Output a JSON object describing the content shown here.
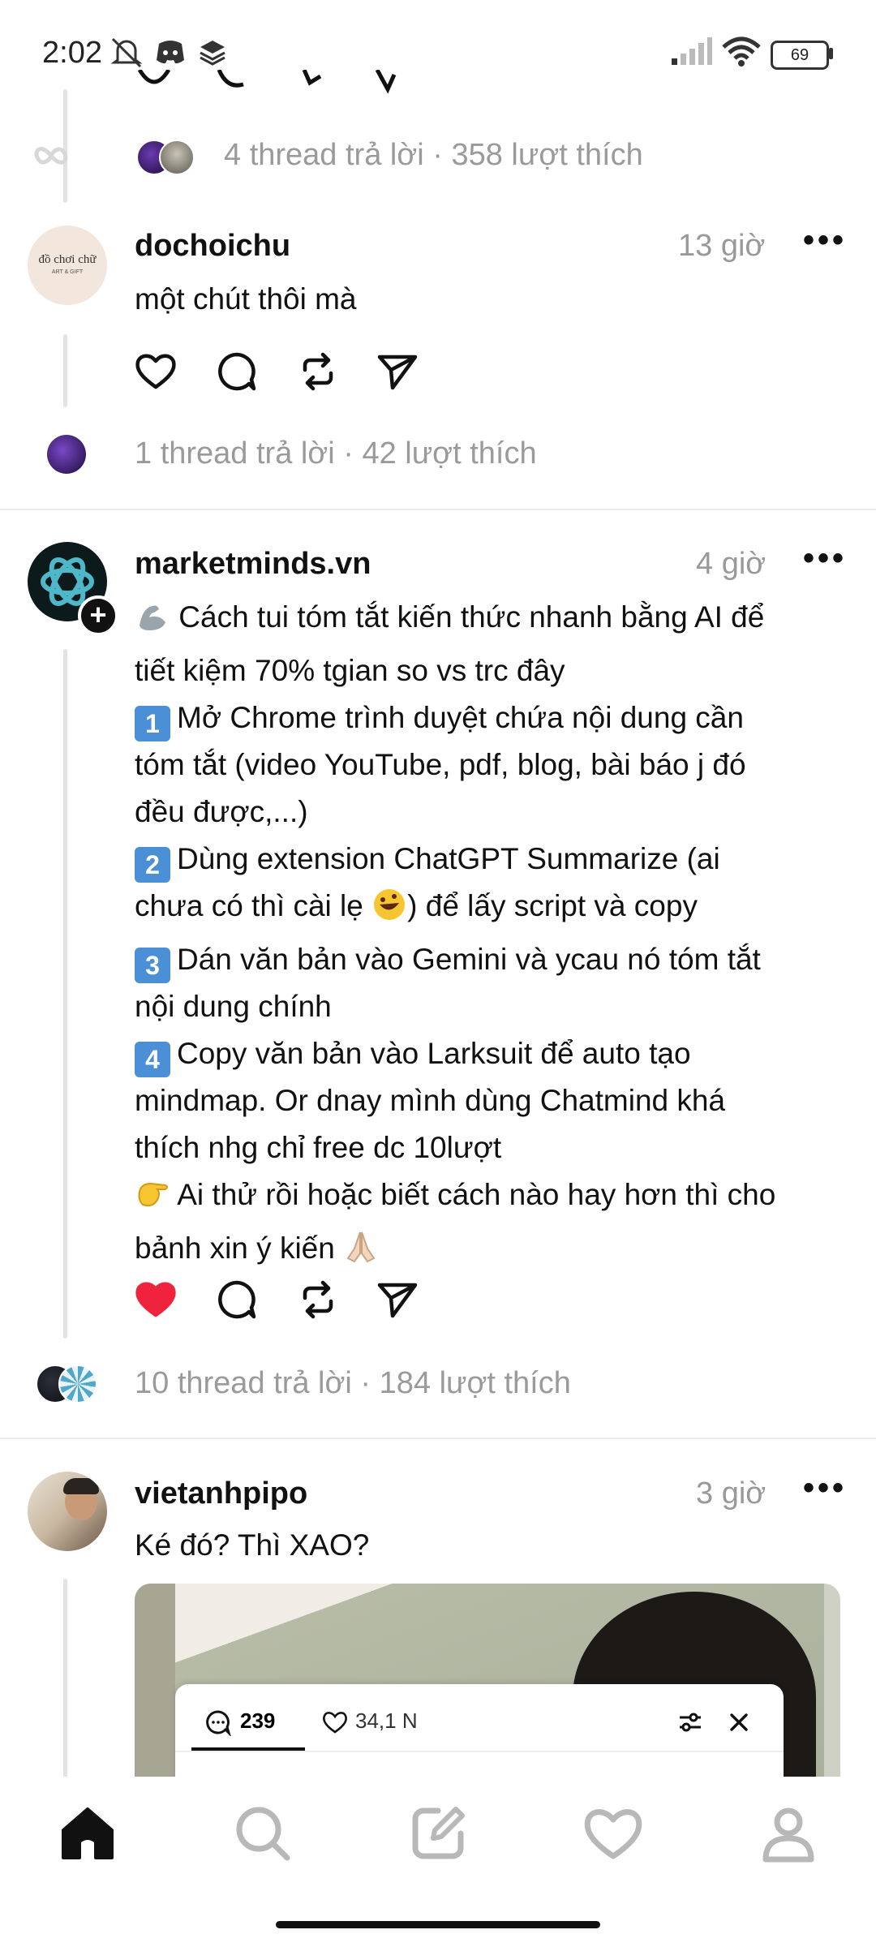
{
  "status_bar": {
    "time": "2:02",
    "battery": "69"
  },
  "top_stub": {
    "stats": "4 thread trả lời · 358 lượt thích"
  },
  "posts": [
    {
      "username": "dochoichu",
      "avatar_text": "đồ chơi chữ",
      "avatar_sub": "ART & GIFT",
      "time": "13 giờ",
      "text": "một chút thôi mà",
      "stats": "1 thread trả lời · 42 lượt thích"
    },
    {
      "username": "marketminds.vn",
      "time": "4 giờ",
      "lines": {
        "l1": "Cách tui tóm tắt kiến thức nhanh bằng AI để",
        "l2": "tiết kiệm 70% tgian so vs trc đây",
        "l3": "Mở Chrome trình duyệt chứa nội dung cần",
        "l4": "tóm tắt (video YouTube, pdf, blog, bài báo j đó",
        "l5": "đều được,...)",
        "l6": "Dùng extension ChatGPT Summarize (ai",
        "l7a": "chưa có thì cài lẹ ",
        "l7b": ") để lấy script và copy",
        "l8": "Dán văn bản vào Gemini và ycau nó tóm tắt",
        "l9": "nội dung chính",
        "l10": "Copy văn bản vào Larksuit để auto tạo",
        "l11": "mindmap. Or dnay mình dùng Chatmind khá",
        "l12": "thích nhg chỉ free dc 10lượt",
        "l13": "Ai thử rồi hoặc biết cách nào hay hơn thì cho",
        "l14": "bảnh xin ý kiến "
      },
      "keycaps": [
        "1",
        "2",
        "3",
        "4"
      ],
      "liked": true,
      "stats": "10 thread trả lời · 184 lượt thích"
    },
    {
      "username": "vietanhpipo",
      "time": "3 giờ",
      "text": "Ké đó? Thì XAO?",
      "media": {
        "comment_count": "239",
        "like_count": "34,1 N"
      }
    }
  ],
  "colors": {
    "like_red": "#f0233e",
    "thread_line": "#e3e3e3"
  },
  "nav": [
    "home-icon",
    "search-icon",
    "compose-icon",
    "heart-icon",
    "profile-icon"
  ]
}
